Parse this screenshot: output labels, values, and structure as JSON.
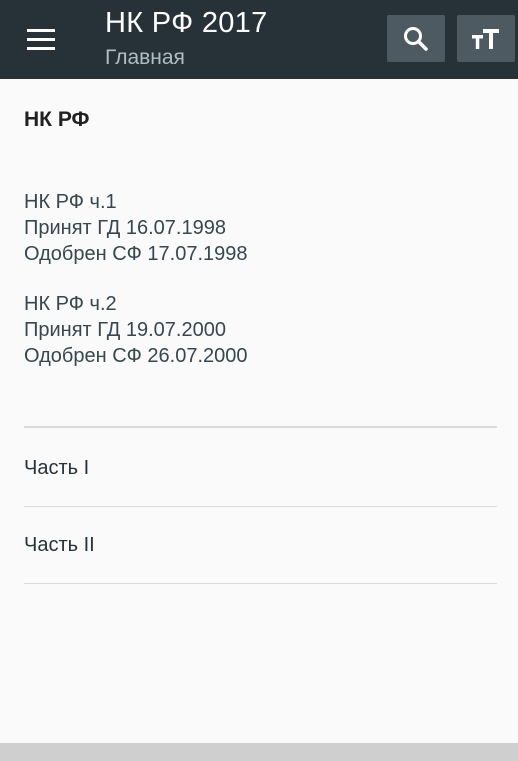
{
  "appbar": {
    "title": "НК РФ 2017",
    "subtitle": "Главная",
    "icons": {
      "menu": "menu-icon",
      "search": "search-icon",
      "text_size": "text-size-icon"
    }
  },
  "main": {
    "heading": "НК РФ",
    "part1_info": [
      "НК РФ ч.1",
      "Принят ГД 16.07.1998",
      "Одобрен СФ 17.07.1998"
    ],
    "part2_info": [
      "НК РФ ч.2",
      "Принят ГД 19.07.2000",
      "Одобрен СФ 26.07.2000"
    ],
    "items": [
      {
        "label": "Часть I"
      },
      {
        "label": "Часть II"
      }
    ]
  },
  "colors": {
    "appbar_bg": "#263238",
    "page_bg": "#fafafa",
    "action_button_bg": "#4d5a62"
  }
}
